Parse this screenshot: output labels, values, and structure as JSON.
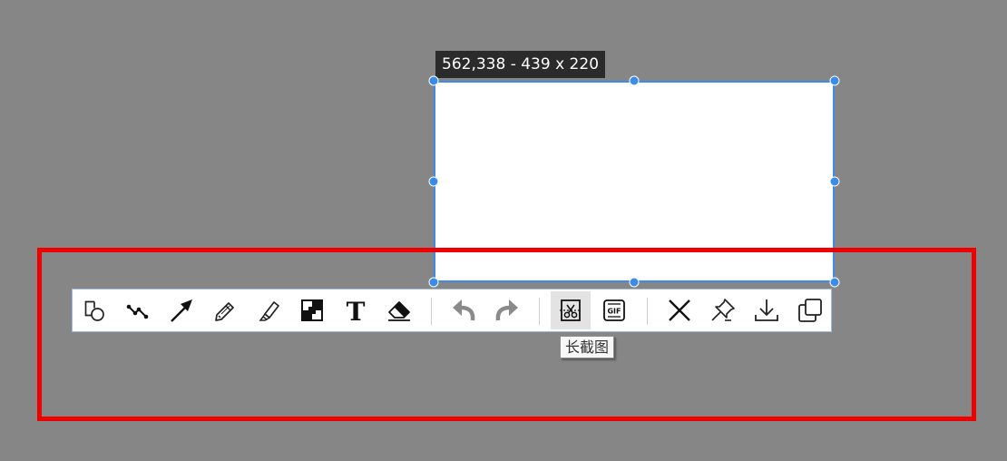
{
  "selection": {
    "size_label": "562,338 - 439 x 220"
  },
  "toolbar": {
    "tools": [
      {
        "name": "shape",
        "icon": "rectangle-circle-icon",
        "interactable": true
      },
      {
        "name": "polyline",
        "icon": "polyline-icon",
        "interactable": true
      },
      {
        "name": "arrow",
        "icon": "arrow-icon",
        "interactable": true
      },
      {
        "name": "pencil",
        "icon": "pencil-icon",
        "interactable": true
      },
      {
        "name": "highlighter",
        "icon": "highlighter-icon",
        "interactable": true
      },
      {
        "name": "mosaic",
        "icon": "mosaic-icon",
        "interactable": true
      },
      {
        "name": "text",
        "icon": "text-icon",
        "interactable": true
      },
      {
        "name": "eraser",
        "icon": "eraser-icon",
        "interactable": true
      },
      {
        "name": "undo",
        "icon": "undo-icon",
        "interactable": false
      },
      {
        "name": "redo",
        "icon": "redo-icon",
        "interactable": false
      },
      {
        "name": "long-screenshot",
        "icon": "long-screenshot-icon",
        "interactable": true,
        "active": true
      },
      {
        "name": "gif-record",
        "icon": "gif-icon",
        "interactable": true
      },
      {
        "name": "close",
        "icon": "close-icon",
        "interactable": true
      },
      {
        "name": "pin",
        "icon": "pin-icon",
        "interactable": true
      },
      {
        "name": "download",
        "icon": "download-icon",
        "interactable": true
      },
      {
        "name": "copy",
        "icon": "copy-icon",
        "interactable": true
      }
    ],
    "gif_icon_text": "GIF",
    "text_icon_glyph": "T"
  },
  "tooltip": {
    "text": "长截图"
  },
  "colors": {
    "background": "#868686",
    "selection_border": "#3b8be8",
    "highlight_box": "#ee0000",
    "disabled_icon": "#8a8a8a"
  }
}
